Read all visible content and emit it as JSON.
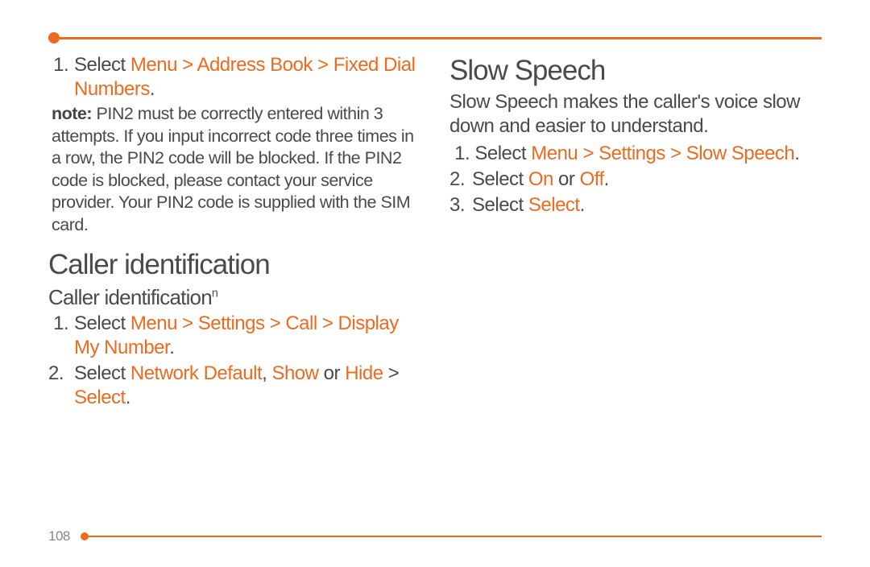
{
  "page_number": "108",
  "left": {
    "step1": {
      "prefix": "Select ",
      "path": "Menu > Address Book > Fixed Dial Numbers",
      "suffix": "."
    },
    "note_label": "note:",
    "note_text": " PIN2 must be correctly entered within 3 attempts. If you input incorrect code three times in a row, the PIN2 code will be blocked. If the PIN2 code is blocked, please contact your service provider. Your PIN2 code is supplied with the SIM card.",
    "section_heading": "Caller identification",
    "sub_heading": "Caller identification",
    "sub_heading_sup": "n",
    "c_step1": {
      "prefix": "Select ",
      "path": "Menu > Settings > Call > Display My Number",
      "suffix": "."
    },
    "c_step2": {
      "seg1": "Select ",
      "nd": "Network Default",
      "comma": ", ",
      "show": "Show",
      "or": " or ",
      "hide": "Hide",
      "gt": " > ",
      "select": "Select",
      "dot": "."
    }
  },
  "right": {
    "section_heading": "Slow Speech",
    "intro": "Slow Speech makes the caller's voice slow down and easier to understand.",
    "s_step1": {
      "prefix": "Select ",
      "path": "Menu > Settings > Slow Speech",
      "suffix": "."
    },
    "s_step2": {
      "seg1": "Select ",
      "on": "On",
      "or": " or ",
      "off": "Off",
      "dot": "."
    },
    "s_step3": {
      "seg1": "Select ",
      "select": "Select",
      "dot": "."
    }
  }
}
